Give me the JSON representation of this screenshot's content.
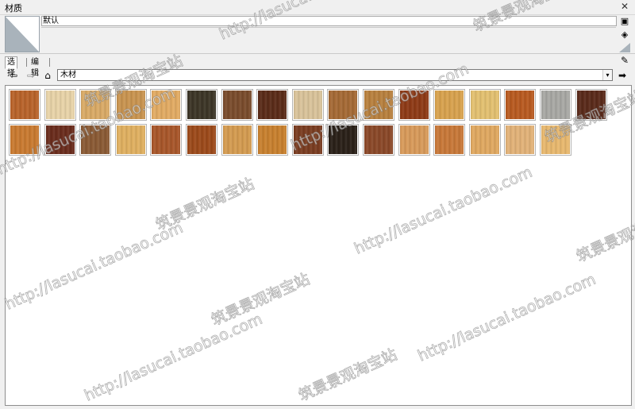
{
  "window": {
    "title": "材质",
    "close_symbol": "✕"
  },
  "material": {
    "name": "默认"
  },
  "side_buttons": {
    "create": "▣",
    "paint": "◈"
  },
  "tabs": [
    {
      "label": "选择"
    },
    {
      "label": "编辑"
    }
  ],
  "navigation": {
    "back": "⇦",
    "forward": "⇨",
    "home": "⌂",
    "go": "➡"
  },
  "collection": {
    "selected": "木材",
    "dropdown_arrow": "▾"
  },
  "tools": {
    "eyedropper": "✎"
  },
  "colors": {
    "preview_gray": "#a9b3bb",
    "border": "#8e8e8e"
  },
  "swatches_row1": [
    "#b8632a",
    "#e8d3a8",
    "#d9aa66",
    "#c99450",
    "#e2ab63",
    "#3c3526",
    "#7a4c2c",
    "#5a2b18",
    "#d9c39a",
    "#a56a35",
    "#b8803e",
    "#8e3a16",
    "#d8a24e",
    "#e3c070",
    "#b85a20",
    "#a8a8a4",
    "#5a2a1a"
  ],
  "swatches_row2": [
    "#c97a30",
    "#6a2c1c",
    "#8a5a34",
    "#e0b060",
    "#a8562a",
    "#9c4a1a",
    "#d49b50",
    "#c8802e",
    "#7a3c20",
    "#2a2018",
    "#8a4828",
    "#d89a5a",
    "#c87838",
    "#e0a860",
    "#e2b278",
    "#e8b86e"
  ],
  "watermark": {
    "url": "http://lasucai.taobao.com",
    "brand": "筑景景观淘宝站"
  }
}
